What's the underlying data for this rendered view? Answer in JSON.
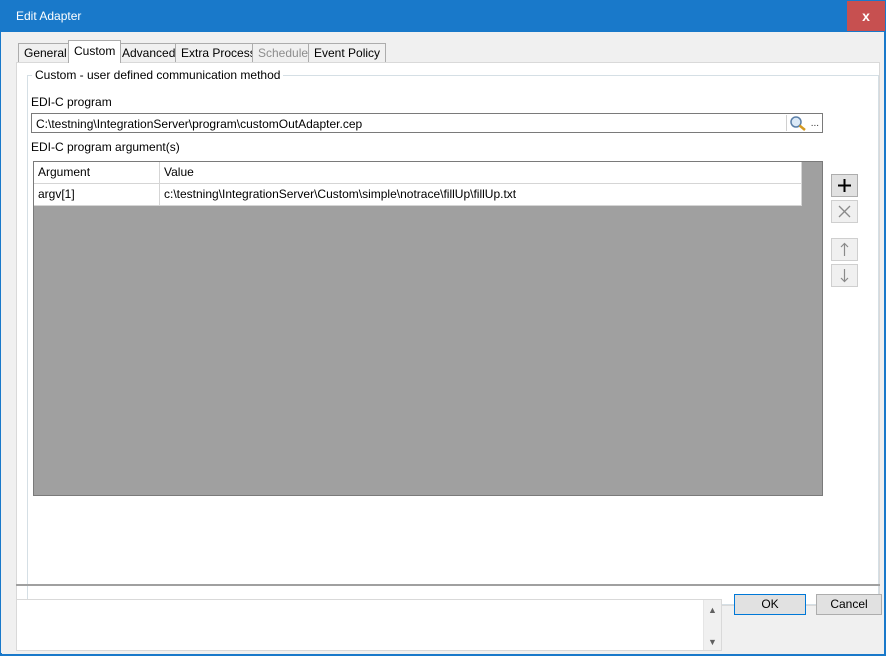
{
  "window": {
    "title": "Edit Adapter",
    "close_label": "x"
  },
  "tabs": [
    {
      "label": "General"
    },
    {
      "label": "Custom"
    },
    {
      "label": "Advanced"
    },
    {
      "label": "Extra Process"
    },
    {
      "label": "Schedule"
    },
    {
      "label": "Event Policy"
    }
  ],
  "group": {
    "legend": "Custom - user defined communication method"
  },
  "program": {
    "label": "EDI-C program",
    "value": "C:\\testning\\IntegrationServer\\program\\customOutAdapter.cep",
    "browse_label": "..."
  },
  "arguments": {
    "label": "EDI-C program argument(s)",
    "columns": [
      "Argument",
      "Value"
    ],
    "rows": [
      {
        "argument": "argv[1]",
        "value": "c:\\testning\\IntegrationServer\\Custom\\simple\\notrace\\fillUp\\fillUp.txt"
      }
    ]
  },
  "buttons": {
    "ok": "OK",
    "cancel": "Cancel"
  },
  "colors": {
    "title_bar": "#1979ca",
    "close": "#c75050",
    "grid_empty": "#a0a0a0"
  }
}
